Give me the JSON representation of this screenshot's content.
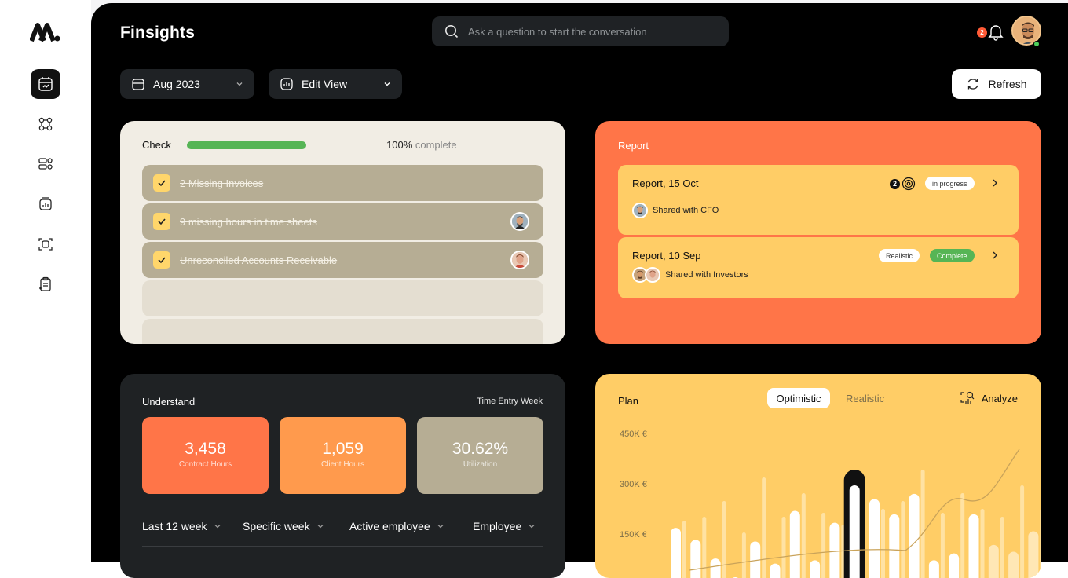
{
  "app": {
    "title": "Finsights"
  },
  "search": {
    "placeholder": "Ask a question to start the conversation"
  },
  "notifications": {
    "count": "2"
  },
  "toolbar": {
    "date_label": "Aug 2023",
    "view_label": "Edit View",
    "refresh_label": "Refresh"
  },
  "check": {
    "title": "Check",
    "progress_value": "100%",
    "progress_suffix": "complete",
    "progress_fraction": 1.0,
    "tasks": [
      {
        "label": "2 Missing Invoices",
        "checked": true,
        "has_avatar": false
      },
      {
        "label": "9  missing hours in time sheets",
        "checked": true,
        "has_avatar": true
      },
      {
        "label": "Unreconciled Accounts Receivable",
        "checked": true,
        "has_avatar": true
      }
    ]
  },
  "report": {
    "title": "Report",
    "items": [
      {
        "title": "Report, 15 Oct",
        "shared": "Shared with CFO",
        "count": "2",
        "status": "in progress"
      },
      {
        "title": "Report, 10 Sep",
        "shared": "Shared with Investors",
        "tag": "Realistic",
        "status": "Complete"
      }
    ]
  },
  "understand": {
    "title": "Understand",
    "subtitle": "Time Entry Week",
    "stats": [
      {
        "value": "3,458",
        "label": "Contract Hours",
        "color": "#ff7548"
      },
      {
        "value": "1,059",
        "label": "Client Hours",
        "color": "#ff9a4d"
      },
      {
        "value": "30.62%",
        "label": "Utilization",
        "color": "#b6ad94"
      }
    ],
    "filters": [
      "Last 12 week",
      "Specific week",
      "Active employee",
      "Employee"
    ]
  },
  "plan": {
    "title": "Plan",
    "toggle": [
      "Optimistic",
      "Realistic"
    ],
    "analyze_label": "Analyze"
  },
  "chart_data": {
    "type": "bar",
    "y_ticks": [
      "450K €",
      "300K €",
      "150K €"
    ],
    "ylim": [
      0,
      450000
    ],
    "values": [
      175000,
      140000,
      85000,
      30000,
      135000,
      70000,
      225000,
      80000,
      190000,
      300000,
      260000,
      215000,
      275000,
      80000,
      100000,
      215000,
      125000,
      105000,
      165000
    ],
    "highlight_index": 9
  },
  "colors": {
    "accent_orange": "#ff7548",
    "accent_yellow": "#ffcd66",
    "progress_green": "#56b555",
    "complete_green": "#56b555"
  },
  "icons": {
    "sidebar": [
      "calendar-icon",
      "nodes-icon",
      "list-settings-icon",
      "chart-board-icon",
      "scan-icon",
      "clipboard-icon"
    ]
  }
}
